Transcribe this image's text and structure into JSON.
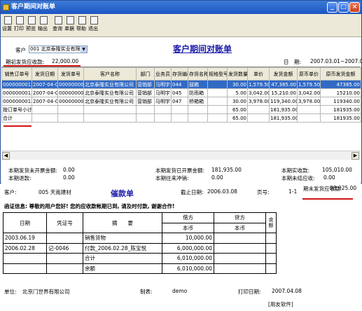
{
  "window": {
    "title": "客户期间对账单"
  },
  "toolbar": {
    "items": [
      "设置",
      "打印",
      "预览",
      "输出",
      "查询",
      "单据",
      "帮助",
      "退出"
    ]
  },
  "form": {
    "customer_label": "客户",
    "customer_value": "001  北京泰隆实业有限公司",
    "report_title": "客户期间对账单",
    "opening_label": "期初发货应收款:",
    "opening_value": "22,000.00",
    "date_label": "日　期:",
    "date_value": "2007.03.01~2007.05.31"
  },
  "grid": {
    "columns": [
      "销售订单号",
      "发货日期",
      "发货单号",
      "客户名称",
      "部门",
      "业务员",
      "存货编码",
      "存货名称",
      "规格型号",
      "发货数量",
      "单价",
      "发货金额",
      "原币单价",
      "原币发货金额"
    ],
    "rows": [
      [
        "0000000012",
        "2007-04-05",
        "0000000011",
        "北京泰隆实业有限公司",
        "营销部",
        "马明宇",
        "044",
        "鼓箱",
        "",
        "30.00",
        "1,579.50",
        "47,385.00",
        "1,579.50",
        "47385.00"
      ],
      [
        "0000000012",
        "2007-04-05",
        "0000000011",
        "北京泰隆实业有限公司",
        "营销部",
        "马明宇",
        "045",
        "防雨箱",
        "",
        "5.00",
        "3,042.00",
        "15,210.00",
        "3,042.00",
        "15210.00"
      ],
      [
        "0000000012",
        "2007-04-05",
        "0000000011",
        "北京泰隆实业有限公司",
        "营销部",
        "马明宇",
        "047",
        "桥箱箱",
        "",
        "30.00",
        "3,978.00",
        "119,340.00",
        "3,978.00",
        "119340.00"
      ],
      [
        "按订单号小计",
        "",
        "",
        "",
        "",
        "",
        "",
        "",
        "",
        "65.00",
        "",
        "181,935.00",
        "",
        "181935.00"
      ],
      [
        "合计",
        "",
        "",
        "",
        "",
        "",
        "",
        "",
        "",
        "65.00",
        "",
        "181,935.00",
        "",
        "181935.00"
      ]
    ]
  },
  "footer": {
    "row1": [
      {
        "label": "本期发货未开票金额:",
        "value": "0.00"
      },
      {
        "label": "本期发货已开票金额:",
        "value": "181,935.00"
      },
      {
        "label": "本期实收款:",
        "value": "105,010.00"
      }
    ],
    "row2": [
      {
        "label": "本期退款:",
        "value": "0.00"
      },
      {
        "label": "本期往来冲销:",
        "value": "0.00"
      },
      {
        "label": "本期未结应收:",
        "value": "0.00"
      }
    ],
    "closing_label": "期末发货应收款:",
    "closing_value": "98,925.00"
  },
  "paper": {
    "customer_label": "客户:",
    "customer_value": "005  天南建材",
    "title": "催款单",
    "cutoff_label": "截止日期:",
    "cutoff_value": "2006.03.08",
    "page_label": "页号:",
    "page_value": "1-1",
    "letter": "函证信息: 尊敬的用户您好! 您的应收款帐期已到, 请及时付款, 谢谢合作!",
    "headers": {
      "date": "日期",
      "voucher": "凭证号",
      "summary": "摘　　要",
      "debit": "借方",
      "credit": "贷方",
      "balance": "余额",
      "currency": "本币"
    },
    "rows": [
      [
        "2003.06.19",
        "",
        "销售货物",
        "10,000.00",
        ""
      ],
      [
        "2006.02.28",
        "记-0046",
        "付款_2006.02.28_陈宝悦",
        "6,000,000.00",
        ""
      ],
      [
        "",
        "",
        "合计",
        "6,010,000.00",
        ""
      ],
      [
        "",
        "",
        "余额",
        "6,010,000.00",
        ""
      ]
    ],
    "unit_label": "单位:",
    "unit_value": "北京门世界有限公司",
    "maker_label": "制表:",
    "maker_value": "demo",
    "printdate_label": "打印日期:",
    "printdate_value": "2007.04.08",
    "brand": "[用友软件]"
  }
}
